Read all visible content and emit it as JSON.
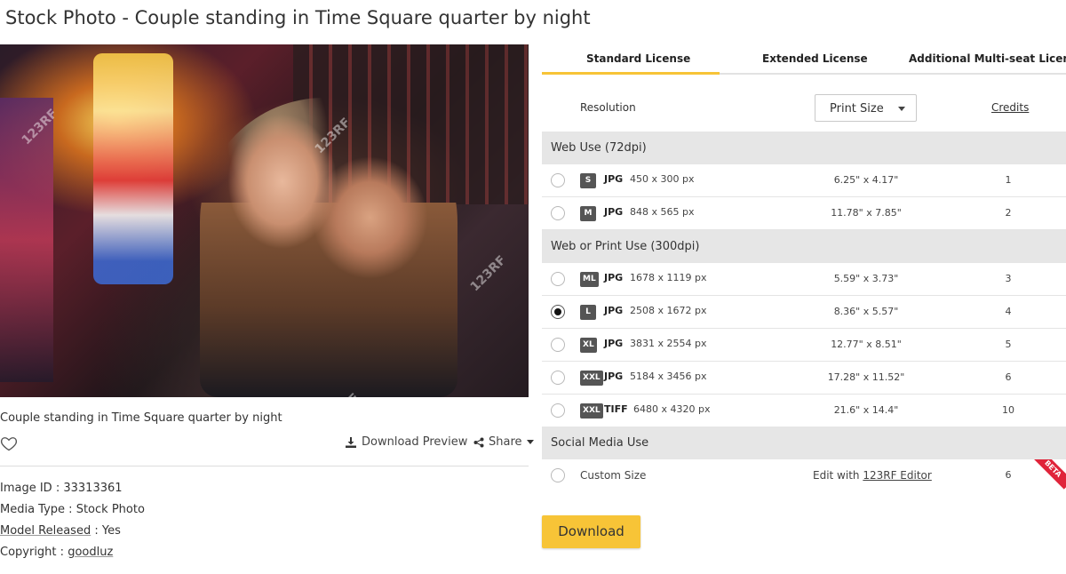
{
  "title": "Stock Photo - Couple standing in Time Square quarter by night",
  "image": {
    "caption": "Couple standing in Time Square quarter by night",
    "watermark": "123RF"
  },
  "actions": {
    "download_preview": "Download Preview",
    "share": "Share"
  },
  "meta": {
    "image_id_label": "Image ID",
    "image_id": "33313361",
    "media_type_label": "Media Type",
    "media_type": "Stock Photo",
    "model_released_label": "Model Released",
    "model_released": "Yes",
    "copyright_label": "Copyright",
    "copyright": "goodluz",
    "separator": " : "
  },
  "license_tabs": [
    {
      "label": "Standard License",
      "active": true
    },
    {
      "label": "Extended License",
      "active": false
    },
    {
      "label": "Additional Multi-seat License",
      "active": false
    }
  ],
  "resolution": {
    "label": "Resolution",
    "select_value": "Print Size",
    "credits_label": "Credits"
  },
  "sections": {
    "web": "Web Use (72dpi)",
    "print": "Web or Print Use (300dpi)",
    "social": "Social Media Use"
  },
  "rows": [
    {
      "size": "S",
      "format": "JPG",
      "px": "450 x 300 px",
      "inches": "6.25\" x 4.17\"",
      "credits": "1",
      "selected": false
    },
    {
      "size": "M",
      "format": "JPG",
      "px": "848 x 565 px",
      "inches": "11.78\" x 7.85\"",
      "credits": "2",
      "selected": false
    },
    {
      "size": "ML",
      "format": "JPG",
      "px": "1678 x 1119 px",
      "inches": "5.59\" x 3.73\"",
      "credits": "3",
      "selected": false
    },
    {
      "size": "L",
      "format": "JPG",
      "px": "2508 x 1672 px",
      "inches": "8.36\" x 5.57\"",
      "credits": "4",
      "selected": true
    },
    {
      "size": "XL",
      "format": "JPG",
      "px": "3831 x 2554 px",
      "inches": "12.77\" x 8.51\"",
      "credits": "5",
      "selected": false
    },
    {
      "size": "XXL",
      "format": "JPG",
      "px": "5184 x 3456 px",
      "inches": "17.28\" x 11.52\"",
      "credits": "6",
      "selected": false
    },
    {
      "size": "XXL",
      "format": "TIFF",
      "px": "6480 x 4320 px",
      "inches": "21.6\" x 14.4\"",
      "credits": "10",
      "selected": false
    }
  ],
  "custom": {
    "label": "Custom Size",
    "edit_prefix": "Edit with ",
    "editor_link": "123RF Editor",
    "credits": "6",
    "badge": "BETA"
  },
  "download_button": "Download",
  "colors": {
    "accent": "#f7c437",
    "section_bg": "#e6e6e6",
    "badge_bg": "#555555",
    "beta": "#e0243a"
  }
}
